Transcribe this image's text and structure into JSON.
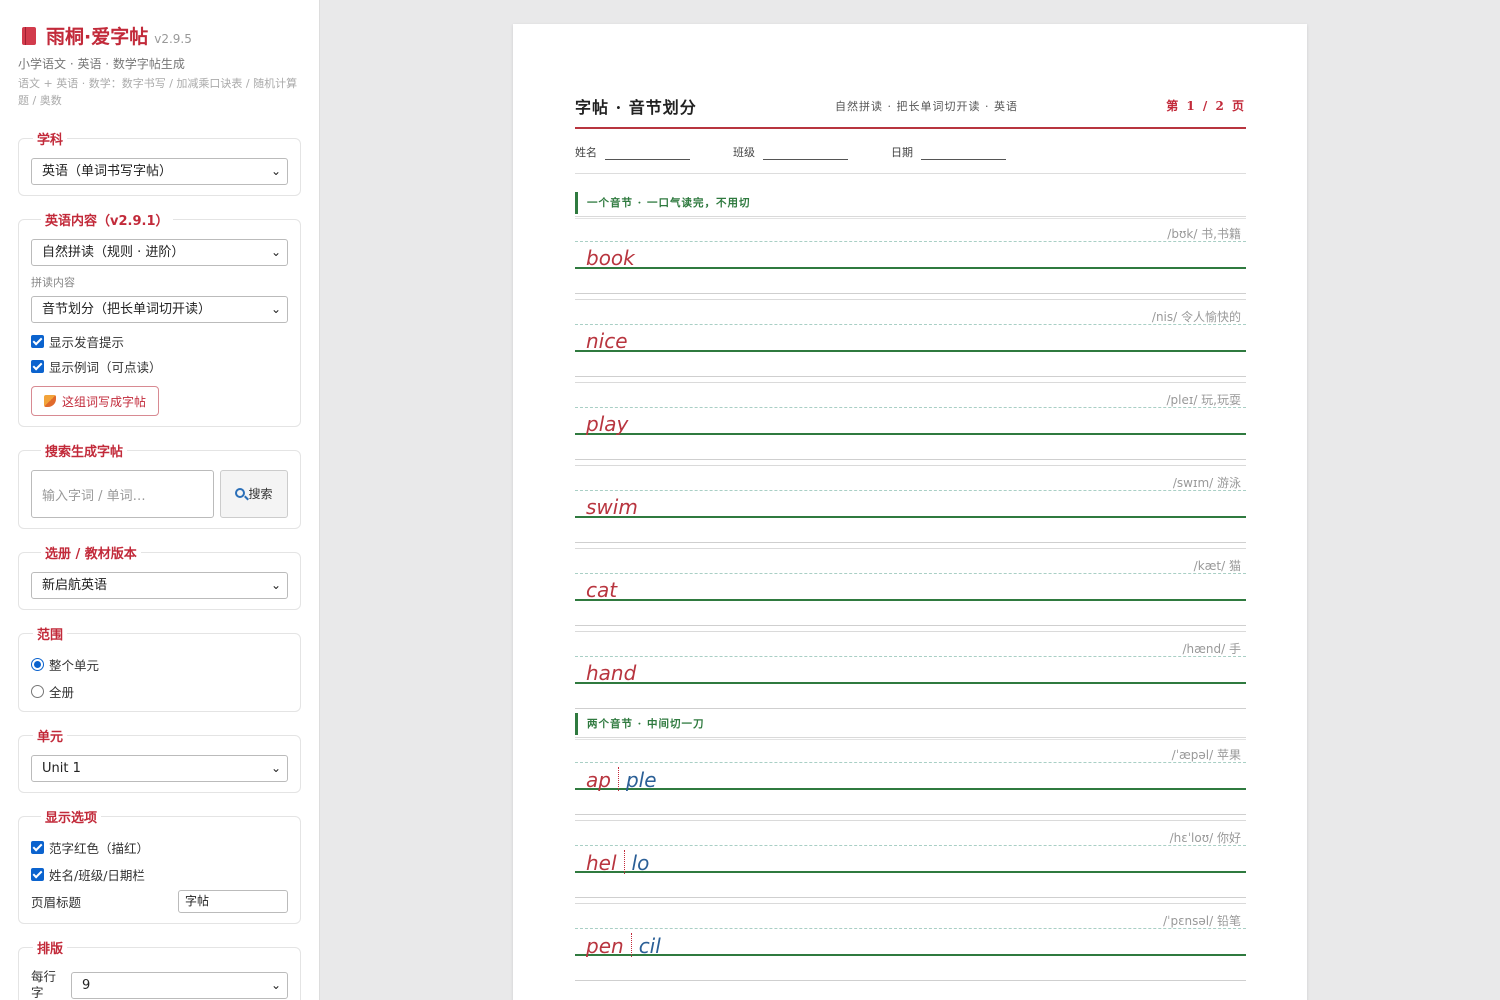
{
  "brand": {
    "title": "雨桐·爱字帖",
    "version": "v2.9.5",
    "subtitle": "小学语文 · 英语 · 数学字帖生成",
    "desc": "语文 + 英语 · 数学：数字书写 / 加减乘口诀表 / 随机计算题 / 奥数"
  },
  "subject": {
    "legend": "学科",
    "selected": "英语（单词书写字帖）"
  },
  "english": {
    "legend": "英语内容（v2.9.1）",
    "mode_selected": "自然拼读（规则 · 进阶）",
    "content_label": "拼读内容",
    "content_selected": "音节划分（把长单词切开读）",
    "opt_phonics": "显示发音提示",
    "opt_examples": "显示例词（可点读）",
    "write_button": "这组词写成字帖"
  },
  "search": {
    "legend": "搜索生成字帖",
    "placeholder": "输入字词 / 单词…",
    "button": "搜索"
  },
  "book": {
    "legend": "选册 / 教材版本",
    "selected": "新启航英语"
  },
  "range": {
    "legend": "范围",
    "options": [
      "整个单元",
      "全册"
    ],
    "selected": "整个单元"
  },
  "unit": {
    "legend": "单元",
    "selected": "Unit 1"
  },
  "display": {
    "legend": "显示选项",
    "opt_red": "范字红色（描红）",
    "opt_info": "姓名/班级/日期栏",
    "header_label": "页眉标题",
    "header_value": "字帖"
  },
  "layout": {
    "legend": "排版",
    "per_row_label": "每行字",
    "per_row_value": "9"
  },
  "worksheet": {
    "title": "字帖 · 音节划分",
    "subtitle": "自然拼读 · 把长单词切开读 · 英语",
    "page": "第 1 / 2 页",
    "name_label": "姓名",
    "class_label": "班级",
    "date_label": "日期",
    "sections": [
      {
        "heading": "一个音节 · 一口气读完，不用切",
        "words": [
          {
            "parts": [
              "book"
            ],
            "phonetic": "/bʊk/ 书,书籍"
          },
          {
            "parts": [
              "nice"
            ],
            "phonetic": "/nis/ 令人愉快的"
          },
          {
            "parts": [
              "play"
            ],
            "phonetic": "/pleɪ/ 玩,玩耍"
          },
          {
            "parts": [
              "swim"
            ],
            "phonetic": "/swɪm/ 游泳"
          },
          {
            "parts": [
              "cat"
            ],
            "phonetic": "/kæt/ 猫"
          },
          {
            "parts": [
              "hand"
            ],
            "phonetic": "/hænd/ 手"
          }
        ]
      },
      {
        "heading": "两个音节 · 中间切一刀",
        "words": [
          {
            "parts": [
              "ap",
              "ple"
            ],
            "phonetic": "/ˈæpəl/ 苹果"
          },
          {
            "parts": [
              "hel",
              "lo"
            ],
            "phonetic": "/hɛˈloʊ/ 你好"
          },
          {
            "parts": [
              "pen",
              "cil"
            ],
            "phonetic": "/ˈpɛnsəl/ 铅笔"
          }
        ]
      }
    ]
  },
  "colors": {
    "accent": "#c22a3a",
    "guide_green": "#2f7a3f",
    "syllable_blue": "#2b5f96",
    "checkbox": "#0b63ce"
  }
}
